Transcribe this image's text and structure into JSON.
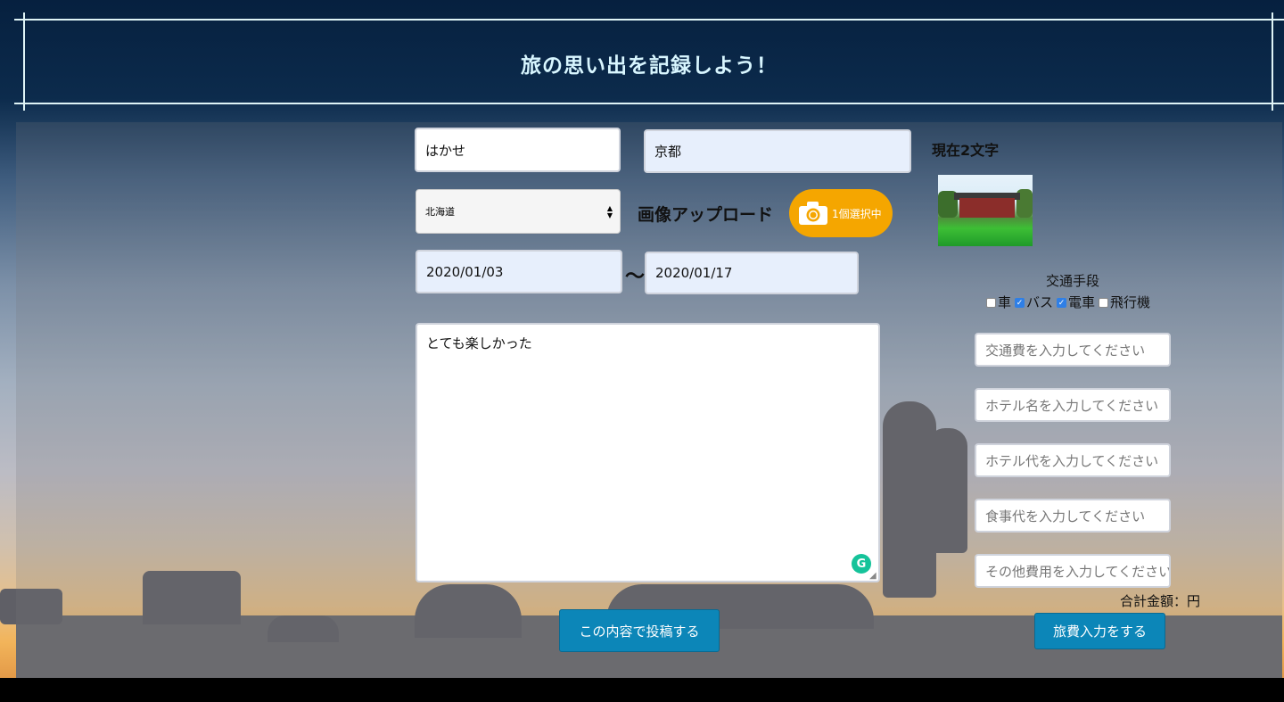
{
  "header": {
    "title": "旅の思い出を記録しよう！"
  },
  "form": {
    "name_value": "はかせ",
    "destination_value": "京都",
    "prefecture_selected": "北海道",
    "upload_label": "画像アップロード",
    "upload_button_label": "1個選択中",
    "start_date": "2020/01/03",
    "date_separator": "〜",
    "end_date": "2020/01/17",
    "memo": "とても楽しかった",
    "char_count": "現在2文字",
    "submit_label": "この内容で投稿する"
  },
  "transport": {
    "title": "交通手段",
    "options": [
      {
        "label": "車",
        "checked": false
      },
      {
        "label": "バス",
        "checked": true
      },
      {
        "label": "電車",
        "checked": true
      },
      {
        "label": "飛行機",
        "checked": false
      }
    ]
  },
  "costs": {
    "transport_placeholder": "交通費を入力してください",
    "hotel_name_placeholder": "ホテル名を入力してください",
    "hotel_cost_placeholder": "ホテル代を入力してください",
    "food_placeholder": "食事代を入力してください",
    "other_placeholder": "その他費用を入力してください",
    "total_label": "合計金額：円",
    "enter_button_label": "旅費入力をする"
  },
  "colors": {
    "accent_button": "#0c86b8",
    "upload_button": "#f5a600",
    "header_text": "#d8f6ff"
  },
  "icons": {
    "upload": "camera-icon",
    "grammarly": "grammarly-icon"
  }
}
